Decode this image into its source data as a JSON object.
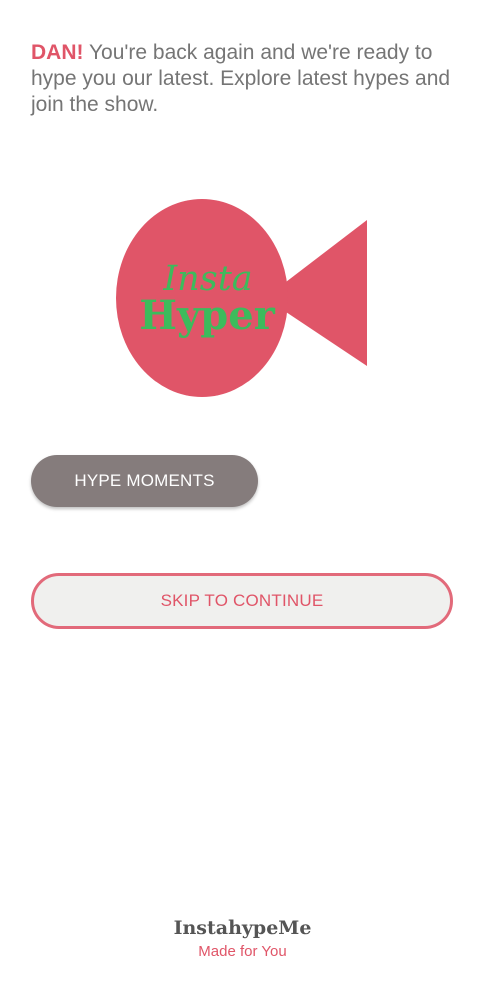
{
  "welcome": {
    "name": "DAN!",
    "message": " You're back again and we're ready to hype you our latest. Explore latest hypes and join the show."
  },
  "logo": {
    "line1": "Insta",
    "line2": "Hyper",
    "icon": "megaphone-logo-icon",
    "shape_color": "#e05568",
    "text_color": "#3dbb5c"
  },
  "buttons": {
    "hype_moments": "HYPE MOMENTS",
    "skip": "SKIP TO CONTINUE"
  },
  "footer": {
    "brand": "InstahypeMe",
    "tagline": "Made for You"
  },
  "colors": {
    "accent": "#e05568",
    "button_gray": "#857c7c",
    "text_gray": "#757575"
  }
}
